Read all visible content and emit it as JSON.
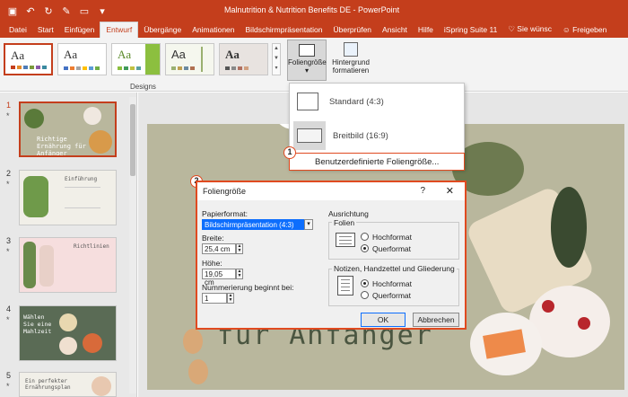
{
  "titlebar": {
    "title": "Malnutrition & Nutrition Benefits DE  -  PowerPoint",
    "qat_icons": [
      "save-icon",
      "undo-icon",
      "redo-icon",
      "format-painter-icon",
      "present-icon",
      "quick-access-customize-icon"
    ]
  },
  "tabs": [
    {
      "label": "Datei",
      "active": false
    },
    {
      "label": "Start",
      "active": false
    },
    {
      "label": "Einfügen",
      "active": false
    },
    {
      "label": "Entwurf",
      "active": true
    },
    {
      "label": "Übergänge",
      "active": false
    },
    {
      "label": "Animationen",
      "active": false
    },
    {
      "label": "Bildschirmpräsentation",
      "active": false
    },
    {
      "label": "Überprüfen",
      "active": false
    },
    {
      "label": "Ansicht",
      "active": false
    },
    {
      "label": "Hilfe",
      "active": false
    },
    {
      "label": "iSpring Suite 11",
      "active": false
    },
    {
      "label": "Sie wünsc",
      "active": false
    },
    {
      "label": "Freigeben",
      "active": false
    }
  ],
  "ribbon": {
    "group_label": "Designs",
    "theme_aa": "Aa",
    "slide_size_label": "Foliengröße",
    "bg_format_line1": "Hintergrund",
    "bg_format_line2": "formatieren",
    "dropdown_caret": "▾",
    "scroll_arrows": [
      "▲",
      "▼",
      "▾"
    ]
  },
  "dropdown": {
    "standard": "Standard (4:3)",
    "wide": "Breitbild (16:9)",
    "custom": "Benutzerdefinierte Foliengröße..."
  },
  "callouts": [
    "1",
    "2"
  ],
  "thumbnails": [
    {
      "num": "1",
      "star": "*",
      "text": "Richtige Ernährung für Anfänger"
    },
    {
      "num": "2",
      "star": "*",
      "text": "Einführung"
    },
    {
      "num": "3",
      "star": "*",
      "text": "Richtlinien"
    },
    {
      "num": "4",
      "star": "*",
      "text": "Wählen Sie eine Mahlzeit"
    },
    {
      "num": "5",
      "star": "*",
      "text": "Ein perfekter Ernährungsplan"
    }
  ],
  "slide": {
    "text": "für Anfänger"
  },
  "dialog": {
    "title": "Foliengröße",
    "help": "?",
    "close": "✕",
    "paper_label": "Papierformat:",
    "paper_value": "Bildschirmpräsentation (4:3)",
    "width_label": "Breite:",
    "width_value": "25,4 cm",
    "height_label": "Höhe:",
    "height_value": "19,05 cm",
    "numbering_label": "Nummerierung beginnt bei:",
    "numbering_value": "1",
    "orientation_label": "Ausrichtung",
    "slides_label": "Folien",
    "portrait": "Hochformat",
    "landscape": "Querformat",
    "notes_label": "Notizen, Handzettel und Gliederung",
    "ok": "OK",
    "cancel": "Abbrechen"
  },
  "colors": {
    "brand": "#c43e1c",
    "highlight": "#e04a20",
    "slide_bg": "#b9b79d",
    "selection": "#0d6efd"
  }
}
